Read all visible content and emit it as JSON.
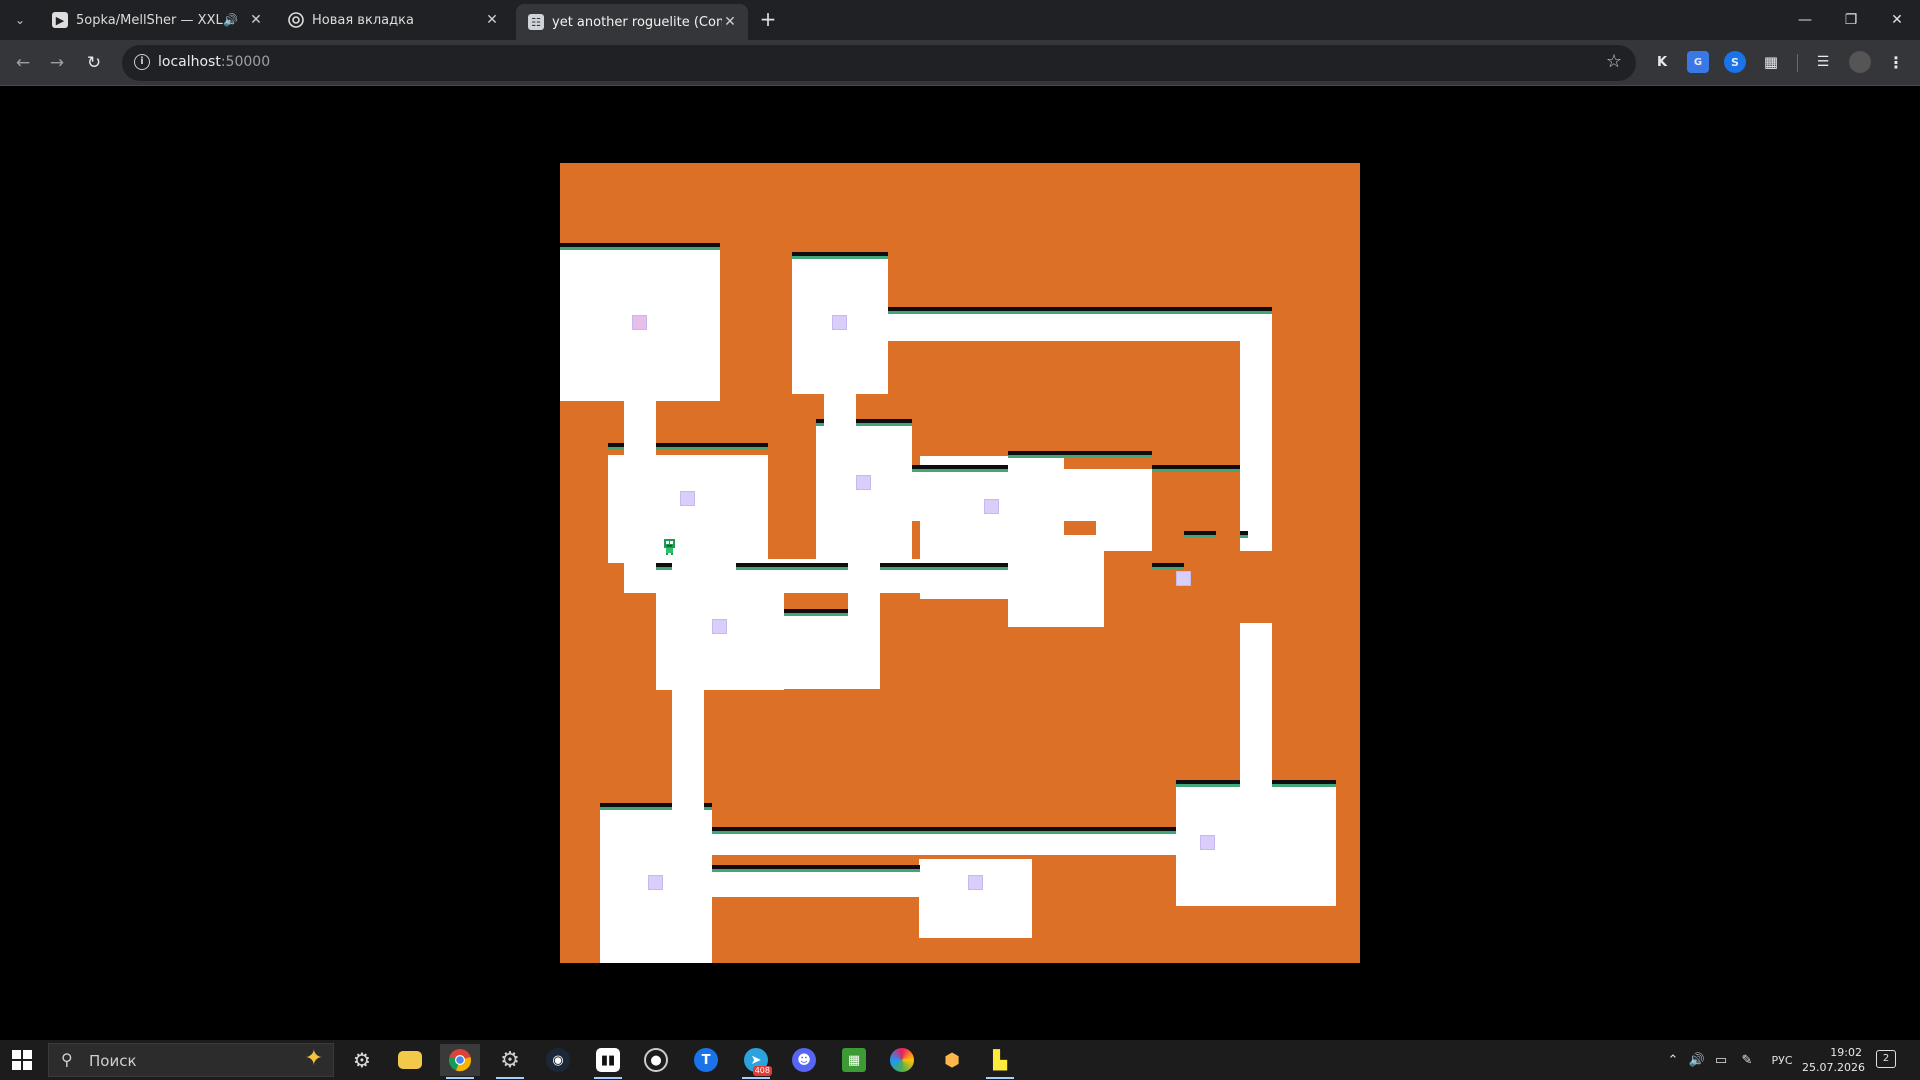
{
  "browser": {
    "tabs": [
      {
        "title": "5opka/MellSher — XXL",
        "favicon": "play-icon",
        "audio": "speaker-icon"
      },
      {
        "title": "Новая вкладка",
        "favicon": "chrome-icon"
      },
      {
        "title": "yet another roguelite (Construct",
        "favicon": "page-icon",
        "active": true
      }
    ],
    "url_host": "localhost",
    "url_port": ":50000",
    "extensions": [
      "K",
      "translate-icon",
      "shazam-icon",
      "puzzle-icon"
    ]
  },
  "game": {
    "background_color": "#dd7027",
    "room_color": "#ffffff",
    "pickup_color": "#d9cdf9",
    "ledge_colors": [
      "#0e0e0e",
      "#43a678"
    ]
  },
  "taskbar": {
    "search_placeholder": "Поиск",
    "telegram_badge": "408",
    "language": "РУС",
    "time": "19:02",
    "date": "25.07.2026",
    "notification_count": "2"
  }
}
